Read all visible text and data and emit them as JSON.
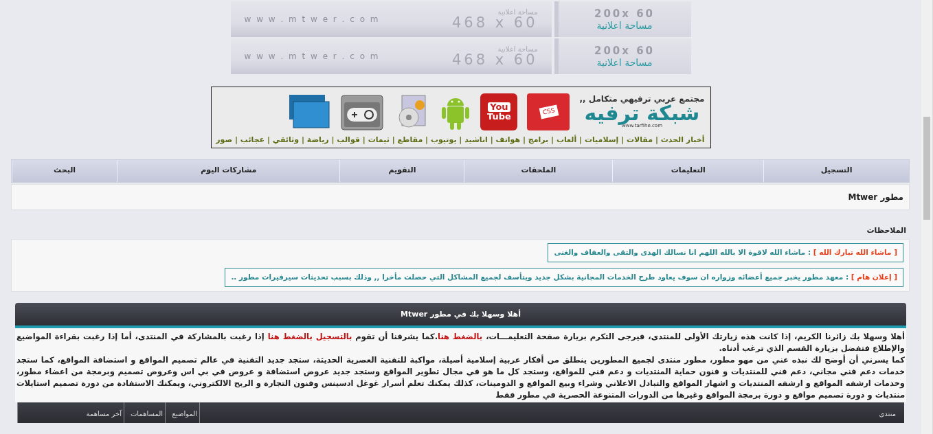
{
  "ads": [
    {
      "wide": {
        "caption": "مساحة اعلانية",
        "size": "468 x 60",
        "site": "w w w . m t w e r . c o m"
      },
      "small": {
        "size": "200x 60",
        "caption": "مساحة اعلانية"
      }
    },
    {
      "wide": {
        "caption": "مساحة اعلانية",
        "size": "468 x 60",
        "site": "w w w . m t w e r . c o m"
      },
      "small": {
        "size": "200x 60",
        "caption": "مساحة اعلانية"
      }
    }
  ],
  "banner": {
    "tagline": "مجتمع عربي ترفيهي متكامل ,,",
    "logo": "شبكة ترفيه",
    "url": "www.tarfihe.com",
    "youtube_label": [
      "You",
      "Tube"
    ],
    "css_label": "CSS",
    "categories": "أخبار الحدث | مقالات | إسلاميات | ألعاب | برامج | هواتف | اناشيد | يوتيوب | مقاطع | ثيمات | قوالب | رياضة | وثائقي | عجائب | صور"
  },
  "navbar": {
    "items": [
      "التسجيل",
      "التعليمات",
      "الملحقات",
      "التقويم",
      "مشاركات اليوم",
      "البحث"
    ]
  },
  "breadcrumb": "مطور Mtwer",
  "notes": {
    "title": "الملاحظات",
    "items": [
      {
        "label": "[ ماشاء الله تبارك الله ]",
        "text": " : ماشاء الله لاقوة الا بالله اللهم انا نسالك الهدى والتقى والعفاف والغنى"
      },
      {
        "label": "[ إعلان هام ]",
        "text": " : معهد مطور يخبر جميع أعضائه وزواره ان سوف يعاود طرح الخدمات المجانية بشكل جديد ويتأسف لجميع المشاكل التي حصلت مأخرا ,, وذلك بسبب تحديثات سيرفيرات مطور .."
      }
    ]
  },
  "welcome": {
    "title": "أهلا وسهلا بك في مطور Mtwer",
    "paragraphs": [
      [
        {
          "kind": "text",
          "text": "أهلا وسهلا بك زائرنا الكريم، إذا كانت هذه زيارتك الأولى للمنتدى، فيرجى التكرم بزيارة صفحة التعليمـــات، "
        },
        {
          "kind": "link",
          "text": "بالضغط هنا"
        },
        {
          "kind": "text",
          "text": ".كما يشرفنا أن تقوم "
        },
        {
          "kind": "link",
          "text": "بالتسجيل بالضغط هنا"
        },
        {
          "kind": "text",
          "text": " إذا رغبت بالمشاركة في المنتدى، أما إذا رغبت بقراءة المواضيع والإطلاع فتفضل بزيارة القسم الذي ترغب أدناه."
        }
      ],
      [
        {
          "kind": "text",
          "text": "كما يسرني أن أوضح لك نبذه عني من مهو مطور، مطور منتدى لجميع المطورين ينطلق من أفكار عربية إسلامية أصيلة، مواكبة للتقنية العصرية الحديثة، ستجد جديد التقنية في عالم تصميم المواقع و استضافة المواقع، كما ستجد خدمات دعم فني مجاني، دعم فني للمنتديات و فنون حماية المنتديات و دعم فني للمواقع، وستجد كل ما هو في مجال تطوير المواقع وستجد جديد عروض استضافة و عروض في بي اس وعروض تصميم وبرمجة من اعضاء مطور، وخدمات ارشفه المواقع و ارشفه المنتديات و اشهار المواقع والتبادل الاعلاني وشراء وبيع المواقع و الدومينات، كذلك يمكنك تعلم أسرار غوغل ادسينس وفنون التجارة و الربح الالكتروني، ويمكنك الاستفادة من دورة تصميم استايلات منتديات و دورة تصميم مواقع و دورة برمجة المواقع وغيرها من الدورات المتنوعة الحصرية في مطور فقط"
        }
      ]
    ]
  },
  "forum_table": {
    "columns": [
      "منتدى",
      "المواضيع",
      "المساهمات",
      "آخر مساهمة"
    ]
  }
}
